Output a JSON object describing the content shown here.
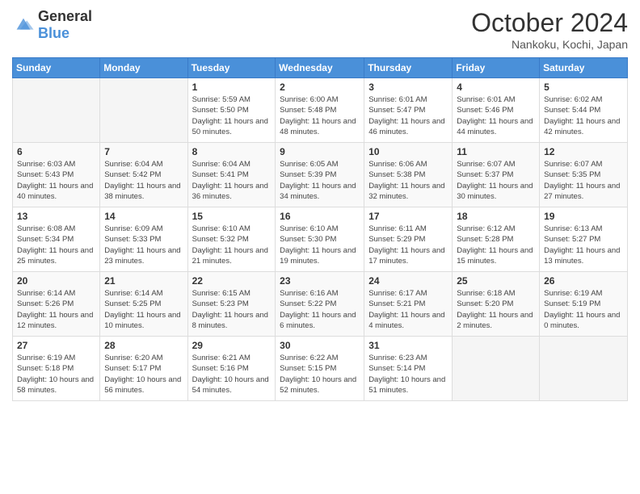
{
  "header": {
    "logo": {
      "general": "General",
      "blue": "Blue"
    },
    "month_title": "October 2024",
    "subtitle": "Nankoku, Kochi, Japan"
  },
  "days_of_week": [
    "Sunday",
    "Monday",
    "Tuesday",
    "Wednesday",
    "Thursday",
    "Friday",
    "Saturday"
  ],
  "weeks": [
    [
      {
        "day": "",
        "info": ""
      },
      {
        "day": "",
        "info": ""
      },
      {
        "day": "1",
        "info": "Sunrise: 5:59 AM\nSunset: 5:50 PM\nDaylight: 11 hours and 50 minutes."
      },
      {
        "day": "2",
        "info": "Sunrise: 6:00 AM\nSunset: 5:48 PM\nDaylight: 11 hours and 48 minutes."
      },
      {
        "day": "3",
        "info": "Sunrise: 6:01 AM\nSunset: 5:47 PM\nDaylight: 11 hours and 46 minutes."
      },
      {
        "day": "4",
        "info": "Sunrise: 6:01 AM\nSunset: 5:46 PM\nDaylight: 11 hours and 44 minutes."
      },
      {
        "day": "5",
        "info": "Sunrise: 6:02 AM\nSunset: 5:44 PM\nDaylight: 11 hours and 42 minutes."
      }
    ],
    [
      {
        "day": "6",
        "info": "Sunrise: 6:03 AM\nSunset: 5:43 PM\nDaylight: 11 hours and 40 minutes."
      },
      {
        "day": "7",
        "info": "Sunrise: 6:04 AM\nSunset: 5:42 PM\nDaylight: 11 hours and 38 minutes."
      },
      {
        "day": "8",
        "info": "Sunrise: 6:04 AM\nSunset: 5:41 PM\nDaylight: 11 hours and 36 minutes."
      },
      {
        "day": "9",
        "info": "Sunrise: 6:05 AM\nSunset: 5:39 PM\nDaylight: 11 hours and 34 minutes."
      },
      {
        "day": "10",
        "info": "Sunrise: 6:06 AM\nSunset: 5:38 PM\nDaylight: 11 hours and 32 minutes."
      },
      {
        "day": "11",
        "info": "Sunrise: 6:07 AM\nSunset: 5:37 PM\nDaylight: 11 hours and 30 minutes."
      },
      {
        "day": "12",
        "info": "Sunrise: 6:07 AM\nSunset: 5:35 PM\nDaylight: 11 hours and 27 minutes."
      }
    ],
    [
      {
        "day": "13",
        "info": "Sunrise: 6:08 AM\nSunset: 5:34 PM\nDaylight: 11 hours and 25 minutes."
      },
      {
        "day": "14",
        "info": "Sunrise: 6:09 AM\nSunset: 5:33 PM\nDaylight: 11 hours and 23 minutes."
      },
      {
        "day": "15",
        "info": "Sunrise: 6:10 AM\nSunset: 5:32 PM\nDaylight: 11 hours and 21 minutes."
      },
      {
        "day": "16",
        "info": "Sunrise: 6:10 AM\nSunset: 5:30 PM\nDaylight: 11 hours and 19 minutes."
      },
      {
        "day": "17",
        "info": "Sunrise: 6:11 AM\nSunset: 5:29 PM\nDaylight: 11 hours and 17 minutes."
      },
      {
        "day": "18",
        "info": "Sunrise: 6:12 AM\nSunset: 5:28 PM\nDaylight: 11 hours and 15 minutes."
      },
      {
        "day": "19",
        "info": "Sunrise: 6:13 AM\nSunset: 5:27 PM\nDaylight: 11 hours and 13 minutes."
      }
    ],
    [
      {
        "day": "20",
        "info": "Sunrise: 6:14 AM\nSunset: 5:26 PM\nDaylight: 11 hours and 12 minutes."
      },
      {
        "day": "21",
        "info": "Sunrise: 6:14 AM\nSunset: 5:25 PM\nDaylight: 11 hours and 10 minutes."
      },
      {
        "day": "22",
        "info": "Sunrise: 6:15 AM\nSunset: 5:23 PM\nDaylight: 11 hours and 8 minutes."
      },
      {
        "day": "23",
        "info": "Sunrise: 6:16 AM\nSunset: 5:22 PM\nDaylight: 11 hours and 6 minutes."
      },
      {
        "day": "24",
        "info": "Sunrise: 6:17 AM\nSunset: 5:21 PM\nDaylight: 11 hours and 4 minutes."
      },
      {
        "day": "25",
        "info": "Sunrise: 6:18 AM\nSunset: 5:20 PM\nDaylight: 11 hours and 2 minutes."
      },
      {
        "day": "26",
        "info": "Sunrise: 6:19 AM\nSunset: 5:19 PM\nDaylight: 11 hours and 0 minutes."
      }
    ],
    [
      {
        "day": "27",
        "info": "Sunrise: 6:19 AM\nSunset: 5:18 PM\nDaylight: 10 hours and 58 minutes."
      },
      {
        "day": "28",
        "info": "Sunrise: 6:20 AM\nSunset: 5:17 PM\nDaylight: 10 hours and 56 minutes."
      },
      {
        "day": "29",
        "info": "Sunrise: 6:21 AM\nSunset: 5:16 PM\nDaylight: 10 hours and 54 minutes."
      },
      {
        "day": "30",
        "info": "Sunrise: 6:22 AM\nSunset: 5:15 PM\nDaylight: 10 hours and 52 minutes."
      },
      {
        "day": "31",
        "info": "Sunrise: 6:23 AM\nSunset: 5:14 PM\nDaylight: 10 hours and 51 minutes."
      },
      {
        "day": "",
        "info": ""
      },
      {
        "day": "",
        "info": ""
      }
    ]
  ]
}
